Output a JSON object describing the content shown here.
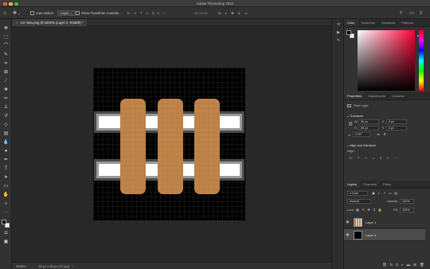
{
  "app": {
    "title": "Adobe Photoshop 2021"
  },
  "options_bar": {
    "home_icon": "home-icon",
    "move_icon": "move-tool-icon",
    "auto_select_label": "Auto-Select:",
    "auto_select_value": "Layer",
    "show_transform_label": "Show Transform Controls",
    "mode_3d_label": "3D Mode:"
  },
  "document": {
    "tab_title": "cnr–bow.png @ 3200% (Layer 2, RGB/8) *",
    "zoom": "3048%",
    "dimensions": "80 px x 80 px (72 ppi)"
  },
  "colors": {
    "pill": "#c0844a",
    "canvas_bg": "#000000",
    "foreground": "#000000",
    "background": "#ffffff",
    "picker_hue": "#ff0033"
  },
  "panels": {
    "color_tabs": [
      "Color",
      "Swatches",
      "Gradients",
      "Patterns"
    ],
    "properties_tabs": [
      "Properties",
      "Adjustments",
      "Libraries"
    ],
    "properties": {
      "kind": "Pixel Layer",
      "transform_header": "Transform",
      "w_label": "W",
      "w_value": "80 px",
      "x_label": "X",
      "x_value": "0 px",
      "h_label": "H",
      "h_value": "80 px",
      "y_label": "Y",
      "y_value": "0 px",
      "angle_value": "0.00°",
      "align_header": "Align and Distribute",
      "align_label": "Align:"
    },
    "layers_tabs": [
      "Layers",
      "Channels",
      "Paths"
    ],
    "layers": {
      "kind_label": "Kind",
      "blend_mode": "Normal",
      "opacity_label": "Opacity:",
      "opacity_value": "100%",
      "lock_label": "Lock:",
      "fill_label": "Fill:",
      "fill_value": "100%",
      "items": [
        {
          "name": "Layer 1",
          "selected": false
        },
        {
          "name": "Layer 2",
          "selected": true
        }
      ]
    }
  }
}
